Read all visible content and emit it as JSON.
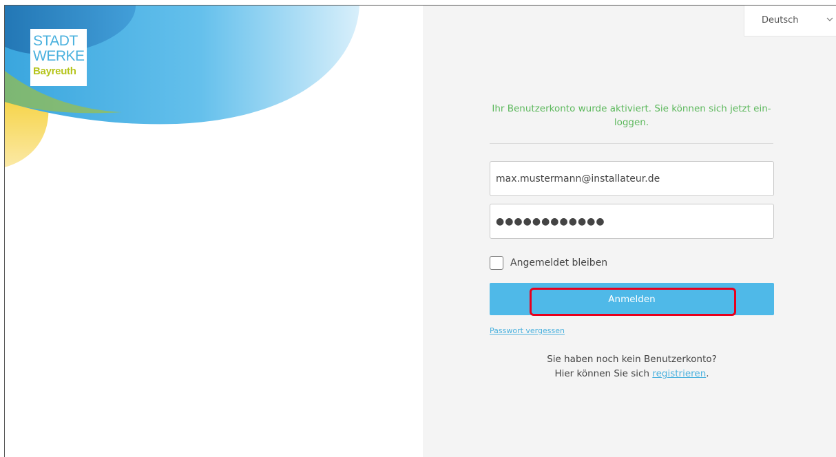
{
  "brand": {
    "logo_line1": "STADT",
    "logo_line2": "WERKE",
    "logo_line3": "Bayreuth",
    "color_blue": "#4ab1de",
    "color_green": "#b5c41c"
  },
  "language": {
    "selected": "Deutsch",
    "icon": "chevron-down-icon"
  },
  "login": {
    "success_message": "Ihr Benutzerkonto wurde aktiviert. Sie können sich jetzt ein-loggen.",
    "email_value": "max.mustermann@installateur.de",
    "password_value": "●●●●●●●●●●●●",
    "remember_label": "Angemeldet bleiben",
    "remember_checked": false,
    "submit_label": "Anmelden",
    "forgot_label": "Passwort vergessen",
    "no_account_text": "Sie haben noch kein Benutzerkonto?",
    "register_prefix": "Hier können Sie sich ",
    "register_link": "registrieren",
    "register_suffix": "."
  },
  "colors": {
    "accent": "#4fb9e8",
    "success": "#5cb85c",
    "highlight": "#e8001c"
  }
}
